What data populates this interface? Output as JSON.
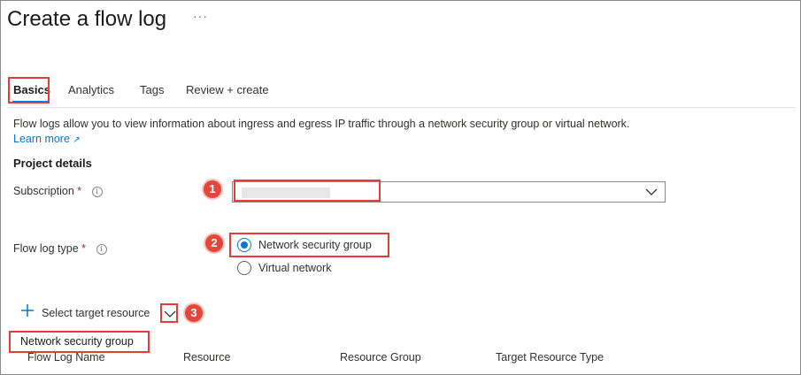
{
  "page": {
    "title": "Create a flow log",
    "more_label": "···"
  },
  "tabs": [
    {
      "label": "Basics",
      "active": true
    },
    {
      "label": "Analytics"
    },
    {
      "label": "Tags"
    },
    {
      "label": "Review + create"
    }
  ],
  "description": {
    "text": "Flow logs allow you to view information about ingress and egress IP traffic through a network security group or virtual network.",
    "link_label": "Learn more"
  },
  "project_details": {
    "heading": "Project details",
    "subscription": {
      "label": "Subscription",
      "required_mark": "*",
      "value": ""
    },
    "flow_log_type": {
      "label": "Flow log type",
      "required_mark": "*",
      "options": [
        {
          "label": "Network security group",
          "selected": true
        },
        {
          "label": "Virtual network",
          "selected": false
        }
      ]
    }
  },
  "target": {
    "select_label": "Select target resource",
    "dropdown_option": "Network security group"
  },
  "table": {
    "columns": [
      "Flow Log Name",
      "Resource",
      "Resource Group",
      "Target Resource Type"
    ]
  },
  "callouts": [
    "1",
    "2",
    "3"
  ],
  "colors": {
    "accent": "#0078d4",
    "highlight": "#e53b3b",
    "required": "#a4262c",
    "badge": "#e3473b"
  },
  "icons": [
    "info-icon",
    "external-link-icon",
    "chevron-down-icon",
    "plus-icon"
  ]
}
